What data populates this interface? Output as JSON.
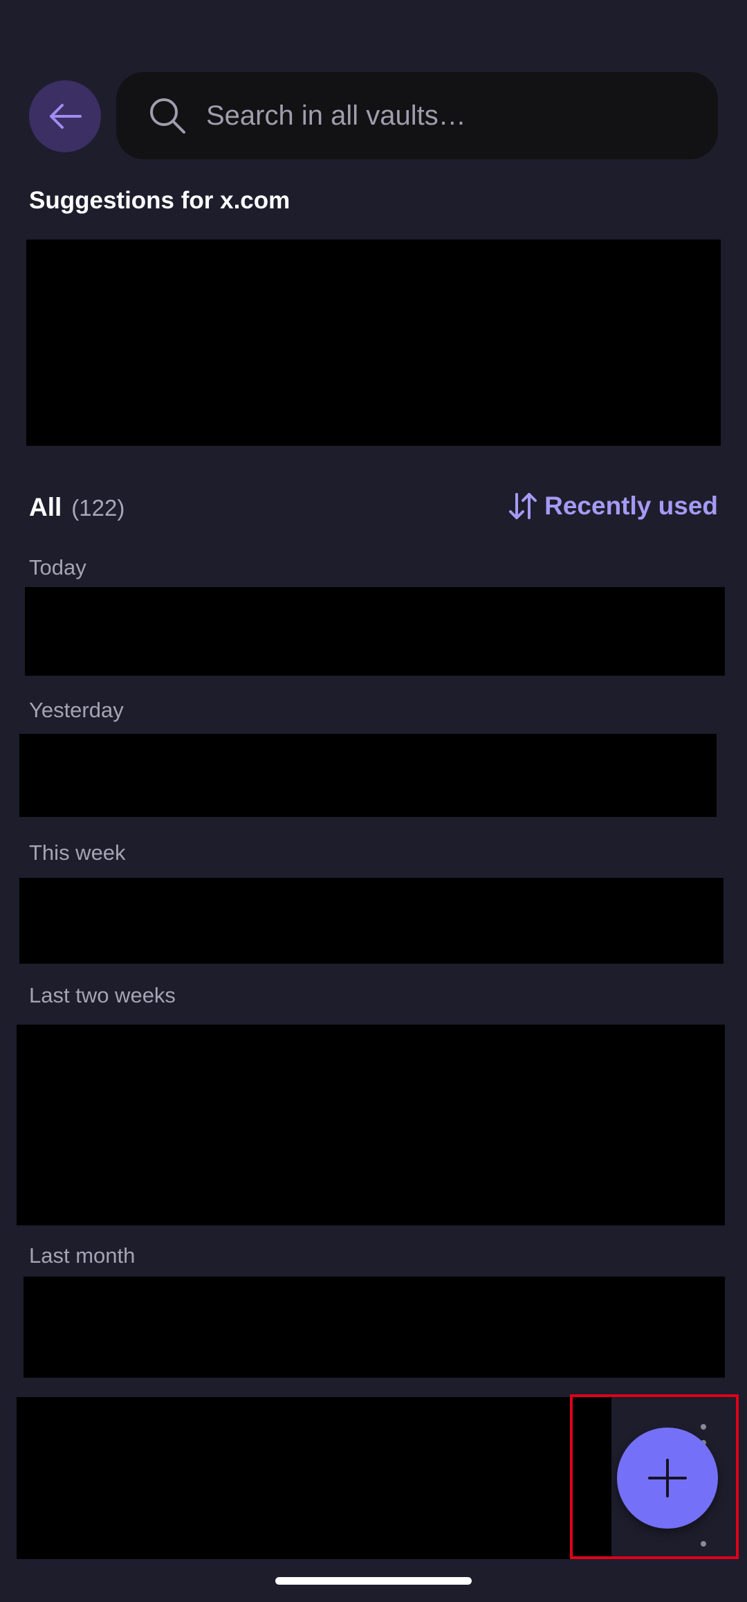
{
  "header": {
    "back_icon": "arrow-left-icon",
    "search_placeholder": "Search in all vaults…",
    "search_value": "",
    "search_icon": "search-icon"
  },
  "suggestions": {
    "title": "Suggestions for x.com"
  },
  "all_section": {
    "label": "All",
    "count": "(122)",
    "sort_label": "Recently used",
    "sort_icon": "sort-arrows-icon"
  },
  "groups": [
    {
      "label": "Today"
    },
    {
      "label": "Yesterday"
    },
    {
      "label": "This week"
    },
    {
      "label": "Last two weeks"
    },
    {
      "label": "Last month"
    }
  ],
  "fab": {
    "icon": "plus-icon"
  },
  "colors": {
    "background": "#1e1d2c",
    "accent": "#7470f7",
    "accent_text": "#a49bf5",
    "back_button": "#3c2f64",
    "search_bg": "#121214",
    "highlight_border": "#e0001a"
  }
}
